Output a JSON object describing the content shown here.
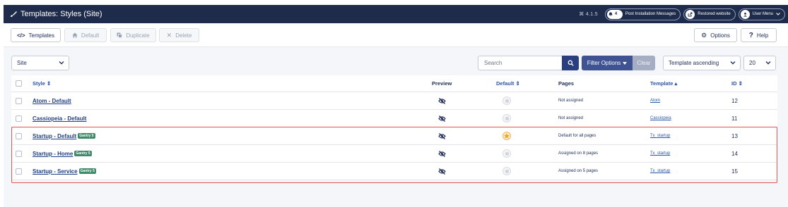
{
  "app": {
    "title": "Templates: Styles (Site)",
    "version": "⌘ 4.1.5",
    "notifications_count": "4",
    "post_install_label": "Post Installation Messages",
    "restored_website_label": "Restored website",
    "user_menu_label": "User Menu"
  },
  "toolbar": {
    "templates_label": "Templates",
    "default_label": "Default",
    "duplicate_label": "Duplicate",
    "delete_label": "Delete",
    "options_label": "Options",
    "help_label": "Help"
  },
  "filters": {
    "client_value": "Site",
    "search_placeholder": "Search",
    "filter_options_label": "Filter Options",
    "clear_label": "Clear",
    "ordering_value": "Template ascending",
    "limit_value": "20"
  },
  "table": {
    "headers": {
      "style": "Style ⇕",
      "preview": "Preview",
      "default": "Default ⇕",
      "pages": "Pages",
      "template": "Template ▴",
      "id": "ID ⇕"
    },
    "rows": [
      {
        "style": "Atom - Default",
        "badge": "",
        "is_default": false,
        "pages": "Not assigned",
        "template": "Atom",
        "id": "12"
      },
      {
        "style": "Cassiopeia - Default",
        "badge": "",
        "is_default": false,
        "pages": "Not assigned",
        "template": "Cassiopeia",
        "id": "11"
      },
      {
        "style": "Startup - Default",
        "badge": "Gantry 5",
        "is_default": true,
        "pages": "Default for all pages",
        "template": "Tx_startup",
        "id": "13"
      },
      {
        "style": "Startup - Home",
        "badge": "Gantry 5",
        "is_default": false,
        "pages": "Assigned on 8 pages",
        "template": "Tx_startup",
        "id": "14"
      },
      {
        "style": "Startup - Service",
        "badge": "Gantry 5",
        "is_default": false,
        "pages": "Assigned on 5 pages",
        "template": "Tx_startup",
        "id": "15"
      }
    ]
  },
  "colors": {
    "header_bg": "#1f2b4a",
    "highlight": "#e35454",
    "badge": "#3e8a6b",
    "accent": "#2a3f80"
  }
}
